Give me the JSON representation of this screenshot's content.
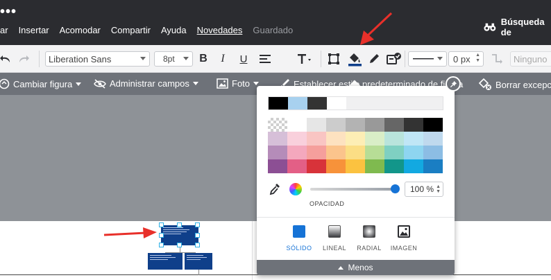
{
  "topbar": {
    "dots": "•••",
    "menu": [
      "ar",
      "Insertar",
      "Acomodar",
      "Compartir",
      "Ayuda",
      "Novedades",
      "Guardado"
    ],
    "search_label": "Búsqueda de"
  },
  "toolbar": {
    "font_family": "Liberation Sans",
    "font_size": "8pt",
    "bold": "B",
    "italic": "I",
    "underline": "U",
    "line_width": "0 px",
    "arrow_style": "Ninguno"
  },
  "toolbar2": {
    "change_shape": "Cambiar figura",
    "manage_fields": "Administrar campos",
    "photo": "Foto",
    "set_default_style": "Establecer estilo predeterminado de figura",
    "clear_exceptions": "Borrar excepc"
  },
  "picker": {
    "recent_colors": [
      "#000000",
      "#a8d1ef",
      "#333333",
      "#ffffff"
    ],
    "palette": [
      [
        "checker",
        "#ffffff",
        "#e6e6e6",
        "#cccccc",
        "#b3b3b3",
        "#999999",
        "#666666",
        "#333333",
        "#000000"
      ],
      [
        "#d6bfd8",
        "#f9d0dc",
        "#f9c5c3",
        "#fde2c0",
        "#fdeeb5",
        "#d9eec7",
        "#b9e4dc",
        "#c0e6f6",
        "#bfd9ee"
      ],
      [
        "#b58cb9",
        "#f4a8bd",
        "#f59f9c",
        "#fbc48c",
        "#fbde85",
        "#b7dd96",
        "#7fd0c2",
        "#8ed5f0",
        "#8cbde4"
      ],
      [
        "#8c4f94",
        "#e35f86",
        "#d8333a",
        "#f7923a",
        "#fbc240",
        "#7fba4f",
        "#12968a",
        "#12a9e1",
        "#1a7ec3"
      ]
    ],
    "opacity_value": "100 %",
    "opacity_level": 1.0,
    "opacity_label": "OPACIDAD",
    "fill_types": [
      "SÓLIDO",
      "LINEAL",
      "RADIAL",
      "IMAGEN"
    ],
    "less_label": "Menos"
  },
  "colors": {
    "accent": "#1673d6",
    "shape_fill": "#0f3f8a",
    "annotation_arrow": "#e8302a"
  }
}
